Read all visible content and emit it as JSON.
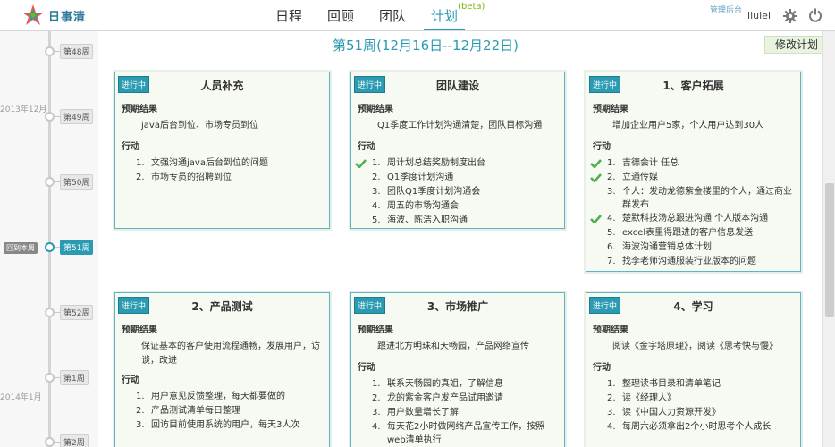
{
  "app": {
    "logo_text": "日事清",
    "nav": [
      {
        "label": "日程",
        "active": false
      },
      {
        "label": "回顾",
        "active": false
      },
      {
        "label": "团队",
        "active": false
      },
      {
        "label": "计划",
        "active": true,
        "sup": "(beta)"
      }
    ],
    "admin_link": "管理后台",
    "username": "liulei"
  },
  "timeline": {
    "months": [
      "2013年12月",
      "2014年1月"
    ],
    "back_today": "回到本周",
    "weeks": [
      {
        "label": "第48周"
      },
      {
        "label": "第49周"
      },
      {
        "label": "第50周"
      },
      {
        "label": "第51周",
        "current": true
      },
      {
        "label": "第52周"
      },
      {
        "label": "第1周"
      },
      {
        "label": "第2周"
      }
    ]
  },
  "main": {
    "week_title": "第51周(12月16日--12月22日)",
    "edit_button": "修改计划",
    "section_expected": "预期结果",
    "section_actions": "行动",
    "colors": {
      "accent": "#2a9bb0",
      "check": "#4caf50"
    }
  },
  "cards": [
    {
      "badge": "进行中",
      "title": "人员补充",
      "expected": "java后台到位、市场专员到位",
      "actions": [
        {
          "num": "1.",
          "text": "文强沟通java后台到位的问题",
          "done": false
        },
        {
          "num": "2.",
          "text": "市场专员的招聘到位",
          "done": false
        }
      ]
    },
    {
      "badge": "进行中",
      "title": "团队建设",
      "expected": "Q1季度工作计划沟通清楚，团队目标沟通",
      "actions": [
        {
          "num": "1.",
          "text": "周计划总结奖励制度出台",
          "done": true
        },
        {
          "num": "2.",
          "text": "Q1季度计划沟通",
          "done": false
        },
        {
          "num": "3.",
          "text": "团队Q1季度计划沟通会",
          "done": false
        },
        {
          "num": "4.",
          "text": "周五的市场沟通会",
          "done": false
        },
        {
          "num": "5.",
          "text": "海波、陈洁入职沟通",
          "done": false
        }
      ]
    },
    {
      "badge": "进行中",
      "title": "1、客户拓展",
      "expected": "增加企业用户5家，个人用户达到30人",
      "actions": [
        {
          "num": "1.",
          "text": "吉德会计 任总",
          "done": true
        },
        {
          "num": "2.",
          "text": "立通传媒",
          "done": true
        },
        {
          "num": "3.",
          "text": "个人：发动龙德紫金楼里的个人，通过商业群发布",
          "done": false,
          "wrap": true
        },
        {
          "num": "4.",
          "text": "楚默科技汤总跟进沟通 个人版本沟通",
          "done": true
        },
        {
          "num": "5.",
          "text": "excel表里得跟进的客户信息发送",
          "done": false
        },
        {
          "num": "6.",
          "text": "海波沟通营销总体计划",
          "done": false
        },
        {
          "num": "7.",
          "text": "找李老师沟通服装行业版本的问题",
          "done": false
        }
      ]
    },
    {
      "badge": "进行中",
      "title": "2、产品测试",
      "expected": "保证基本的客户使用流程通畅，发展用户，访谈，改进",
      "actions": [
        {
          "num": "1.",
          "text": "用户意见反馈整理，每天都要做的",
          "done": false
        },
        {
          "num": "2.",
          "text": "产品测试清单每日整理",
          "done": false
        },
        {
          "num": "3.",
          "text": "回访目前使用系统的用户，每天3人次",
          "done": false
        }
      ]
    },
    {
      "badge": "进行中",
      "title": "3、市场推广",
      "expected": "跟进北方明珠和天畅园，产品网络宣传",
      "actions": [
        {
          "num": "1.",
          "text": "联系天畅园的真姐，了解信息",
          "done": false
        },
        {
          "num": "2.",
          "text": "龙的紫金客户发产品试用邀请",
          "done": false
        },
        {
          "num": "3.",
          "text": "用户数量增长了解",
          "done": false
        },
        {
          "num": "4.",
          "text": "每天花2小时做网络产品宣传工作，按照web清单执行",
          "done": false,
          "wrap": true
        }
      ]
    },
    {
      "badge": "进行中",
      "title": "4、学习",
      "expected": "阅读《金字塔原理》，阅读《思考快与慢》",
      "actions": [
        {
          "num": "1.",
          "text": "整理读书目录和清单笔记",
          "done": false
        },
        {
          "num": "2.",
          "text": "读《经理人》",
          "done": false
        },
        {
          "num": "3.",
          "text": "读《中国人力资源开发》",
          "done": false
        },
        {
          "num": "4.",
          "text": "每周六必须拿出2个小时思考个人成长",
          "done": false
        }
      ]
    }
  ]
}
